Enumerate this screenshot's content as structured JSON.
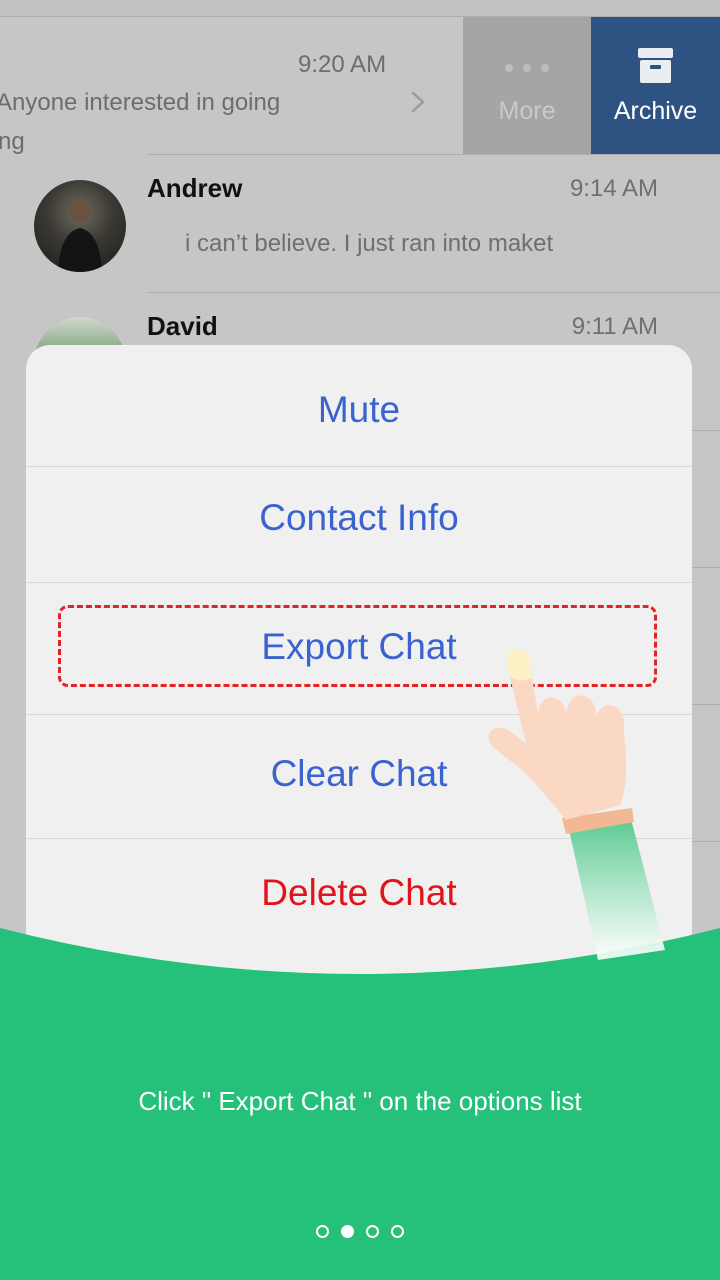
{
  "swiped_chat": {
    "time": "9:20 AM",
    "preview_line1": "Anyone interested in going",
    "preview_line2": "ng",
    "more_label": "More",
    "archive_label": "Archive"
  },
  "chats": [
    {
      "name": "Andrew",
      "time": "9:14 AM",
      "message": "i can’t believe. I just ran into maket"
    },
    {
      "name": "David",
      "time": "9:11 AM",
      "message": ""
    }
  ],
  "options": [
    {
      "label": "Mute"
    },
    {
      "label": "Contact Info"
    },
    {
      "label": "Export Chat"
    },
    {
      "label": "Clear Chat"
    },
    {
      "label": "Delete Chat"
    }
  ],
  "hint": "Click \" Export Chat \" on the options list",
  "pager": {
    "count": 4,
    "active_index": 1
  },
  "colors": {
    "accent_blue": "#3b63d0",
    "destructive_red": "#e0141a",
    "archive_blue": "#2e5382",
    "green": "#25c07a",
    "highlight_red": "#e52225"
  }
}
